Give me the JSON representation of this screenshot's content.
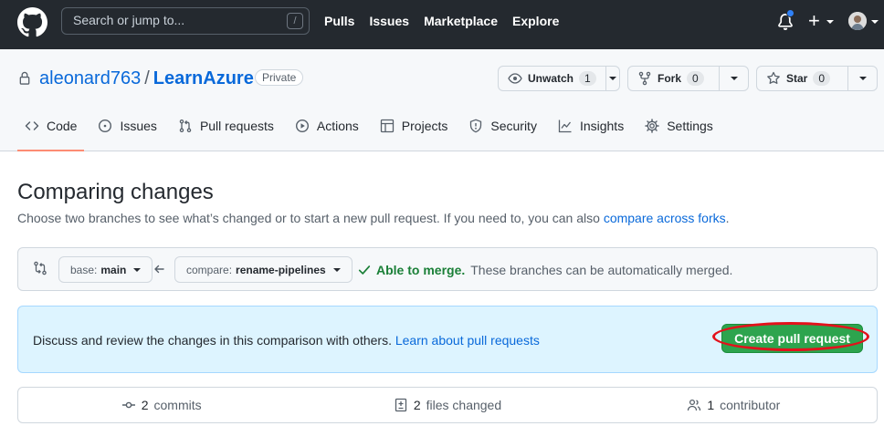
{
  "header": {
    "search_placeholder": "Search or jump to...",
    "search_shortcut": "/",
    "nav": [
      "Pulls",
      "Issues",
      "Marketplace",
      "Explore"
    ]
  },
  "repo": {
    "owner": "aleonard763",
    "separator": "/",
    "name": "LearnAzure",
    "visibility": "Private",
    "watch": {
      "label": "Unwatch",
      "count": "1"
    },
    "fork": {
      "label": "Fork",
      "count": "0"
    },
    "star": {
      "label": "Star",
      "count": "0"
    }
  },
  "tabs": [
    {
      "label": "Code",
      "icon": "code-icon",
      "active": true
    },
    {
      "label": "Issues",
      "icon": "issue-opened-icon"
    },
    {
      "label": "Pull requests",
      "icon": "git-pull-request-icon"
    },
    {
      "label": "Actions",
      "icon": "play-icon"
    },
    {
      "label": "Projects",
      "icon": "table-icon"
    },
    {
      "label": "Security",
      "icon": "shield-icon"
    },
    {
      "label": "Insights",
      "icon": "graph-icon"
    },
    {
      "label": "Settings",
      "icon": "gear-icon"
    }
  ],
  "compare": {
    "title": "Comparing changes",
    "description": "Choose two branches to see what’s changed or to start a new pull request. If you need to, you can also ",
    "forks_link": "compare across forks",
    "description_end": ".",
    "base_key": "base:",
    "base_value": "main",
    "compare_key": "compare:",
    "compare_value": "rename-pipelines",
    "merge_status": "Able to merge.",
    "merge_detail": "These branches can be automatically merged."
  },
  "flash": {
    "text": "Discuss and review the changes in this comparison with others. ",
    "link": "Learn about pull requests",
    "button": "Create pull request"
  },
  "summary": {
    "commits_count": "2",
    "commits_label": "commits",
    "files_count": "2",
    "files_label": "files changed",
    "contrib_count": "1",
    "contrib_label": "contributor"
  },
  "colors": {
    "header_bg": "#24292f",
    "link": "#0969da",
    "primary_button": "#2da44e",
    "active_tab_underline": "#fd8c73",
    "flash_bg": "#ddf4ff",
    "success_text": "#1a7f37",
    "annotation_ring": "#e3111b"
  }
}
